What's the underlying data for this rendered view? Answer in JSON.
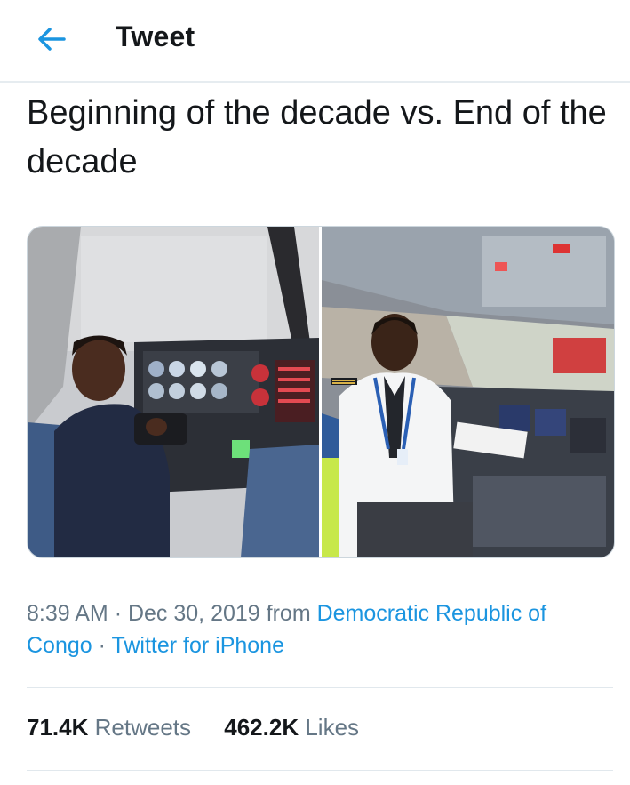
{
  "header": {
    "title": "Tweet",
    "back_icon": "arrow-left-icon",
    "accent": "#1b95e0"
  },
  "tweet": {
    "text": "Beginning of the decade vs. End of the decade",
    "media": [
      {
        "name": "photo-beginning"
      },
      {
        "name": "photo-end"
      }
    ],
    "meta": {
      "time": "8:39 AM",
      "date": "Dec 30, 2019",
      "from_label": "from",
      "location": "Democratic Republic of Congo",
      "source": "Twitter for iPhone"
    },
    "stats": {
      "retweets_count": "71.4K",
      "retweets_label": "Retweets",
      "likes_count": "462.2K",
      "likes_label": "Likes"
    }
  }
}
